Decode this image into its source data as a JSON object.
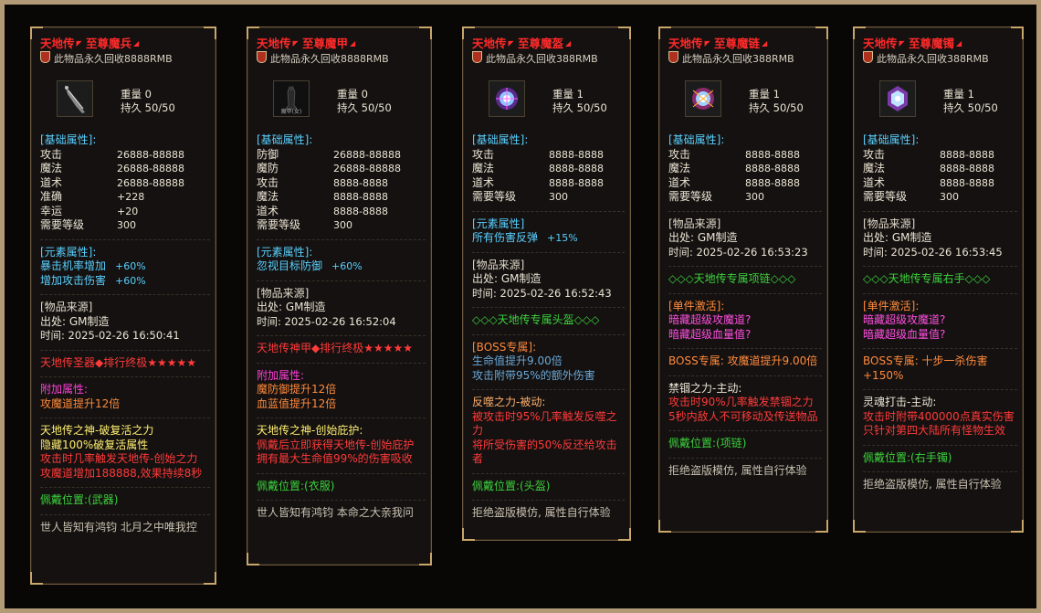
{
  "cards": [
    {
      "title": "天地传",
      "name": "至尊魔兵",
      "recycle": "此物品永久回收8888RMB",
      "weight_label": "重量",
      "weight": "0",
      "dur_label": "持久",
      "dur": "50/50",
      "basic_header": "[基础属性]:",
      "basic": [
        {
          "k": "攻击",
          "v": "26888-88888"
        },
        {
          "k": "魔法",
          "v": "26888-88888"
        },
        {
          "k": "道术",
          "v": "26888-88888"
        },
        {
          "k": "准确",
          "v": "+228"
        },
        {
          "k": "幸运",
          "v": "+20"
        },
        {
          "k": "需要等级",
          "v": "300"
        }
      ],
      "elem_header": "[元素属性]:",
      "elem": [
        {
          "k": "暴击机率增加",
          "v": "+60%"
        },
        {
          "k": "增加攻击伤害",
          "v": "+60%"
        }
      ],
      "source_header": "[物品来源]",
      "source_from": "出处: GM制造",
      "source_time": "时间: 2025-02-26 16:50:41",
      "rank_line": "天地传圣器◆排行终极★★★★★",
      "extra_header": "附加属性:",
      "extra": [
        "攻魔道提升12倍"
      ],
      "god_title": "天地传之神-破复活之力",
      "god_sub": "隐藏100%破复活属性",
      "god_desc": [
        "攻击时几率触发天地传-创始之力",
        "攻魔道增加188888,效果持续8秒"
      ],
      "slot": "佩戴位置:(武器)",
      "footer": "世人皆知有鸿钧 北月之中唯我控"
    },
    {
      "title": "天地传",
      "name": "至尊魔甲",
      "recycle": "此物品永久回收8888RMB",
      "weight_label": "重量",
      "weight": "0",
      "dur_label": "持久",
      "dur": "50/50",
      "icon_text": "魔甲(女)",
      "basic_header": "[基础属性]:",
      "basic": [
        {
          "k": "防御",
          "v": "26888-88888"
        },
        {
          "k": "魔防",
          "v": "26888-88888"
        },
        {
          "k": "攻击",
          "v": "8888-8888"
        },
        {
          "k": "魔法",
          "v": "8888-8888"
        },
        {
          "k": "道术",
          "v": "8888-8888"
        },
        {
          "k": "需要等级",
          "v": "300"
        }
      ],
      "elem_header": "[元素属性]:",
      "elem": [
        {
          "k": "忽视目标防御",
          "v": "+60%"
        }
      ],
      "source_header": "[物品来源]",
      "source_from": "出处: GM制造",
      "source_time": "时间: 2025-02-26 16:52:04",
      "rank_line": "天地传神甲◆排行终极★★★★★",
      "extra_header": "附加属性:",
      "extra": [
        "魔防御提升12倍",
        "血蓝值提升12倍"
      ],
      "god_title": "天地传之神-创始庇护:",
      "god_desc": [
        "佩戴后立即获得天地传-创始庇护",
        "拥有最大生命值99%的伤害吸收"
      ],
      "slot": "佩戴位置:(衣服)",
      "footer": "世人皆知有鸿钧 本命之大亲我问"
    },
    {
      "title": "天地传",
      "name": "至尊魔盔",
      "recycle": "此物品永久回收388RMB",
      "weight_label": "重量",
      "weight": "1",
      "dur_label": "持久",
      "dur": "50/50",
      "basic_header": "[基础属性]:",
      "basic": [
        {
          "k": "攻击",
          "v": "8888-8888"
        },
        {
          "k": "魔法",
          "v": "8888-8888"
        },
        {
          "k": "道术",
          "v": "8888-8888"
        },
        {
          "k": "需要等级",
          "v": "300"
        }
      ],
      "elem_header": "[元素属性]",
      "elem": [
        {
          "k": "所有伤害反弹",
          "v": "+15%"
        }
      ],
      "source_header": "[物品来源]",
      "source_from": "出处: GM制造",
      "source_time": "时间: 2025-02-26 16:52:43",
      "exclusive": "◇◇◇天地传专属头盔◇◇◇",
      "boss_header": "[BOSS专属]:",
      "boss_lines": [
        "生命值提升9.00倍",
        "攻击附带95%的额外伤害"
      ],
      "skill_title": "反噬之力-被动:",
      "skill_desc": [
        "被攻击时95%几率触发反噬之力",
        "将所受伤害的50%反还给攻击者"
      ],
      "slot": "佩戴位置:(头盔)",
      "footer": "拒绝盗版模仿, 属性自行体验"
    },
    {
      "title": "天地传",
      "name": "至尊魔链",
      "recycle": "此物品永久回收388RMB",
      "weight_label": "重量",
      "weight": "1",
      "dur_label": "持久",
      "dur": "50/50",
      "basic_header": "[基础属性]:",
      "basic": [
        {
          "k": "攻击",
          "v": "8888-8888"
        },
        {
          "k": "魔法",
          "v": "8888-8888"
        },
        {
          "k": "道术",
          "v": "8888-8888"
        },
        {
          "k": "需要等级",
          "v": "300"
        }
      ],
      "source_header": "[物品来源]",
      "source_from": "出处: GM制造",
      "source_time": "时间: 2025-02-26 16:53:23",
      "exclusive": "◇◇◇天地传专属项链◇◇◇",
      "single_header": "[单件激活]:",
      "single_lines": [
        "暗藏超级攻魔道?",
        "暗藏超级血量值?"
      ],
      "boss_line": "BOSS专属: 攻魔道提升9.00倍",
      "skill_title": "禁锢之力-主动:",
      "skill_desc": [
        "攻击时90%几率触发禁锢之力",
        "5秒内敌人不可移动及传送物品"
      ],
      "slot": "佩戴位置:(项链)",
      "footer": "拒绝盗版模仿, 属性自行体验"
    },
    {
      "title": "天地传",
      "name": "至尊魔镯",
      "recycle": "此物品永久回收388RMB",
      "weight_label": "重量",
      "weight": "1",
      "dur_label": "持久",
      "dur": "50/50",
      "basic_header": "[基础属性]:",
      "basic": [
        {
          "k": "攻击",
          "v": "8888-8888"
        },
        {
          "k": "魔法",
          "v": "8888-8888"
        },
        {
          "k": "道术",
          "v": "8888-8888"
        },
        {
          "k": "需要等级",
          "v": "300"
        }
      ],
      "source_header": "[物品来源]",
      "source_from": "出处: GM制造",
      "source_time": "时间: 2025-02-26 16:53:45",
      "exclusive": "◇◇◇天地传专属右手◇◇◇",
      "single_header": "[单件激活]:",
      "single_lines": [
        "暗藏超级攻魔道?",
        "暗藏超级血量值?"
      ],
      "boss_line": "BOSS专属: 十步一杀伤害+150%",
      "skill_title": "灵魂打击-主动:",
      "skill_desc": [
        "攻击时附带400000点真实伤害",
        "只针对第四大陆所有怪物生效"
      ],
      "slot": "佩戴位置:(右手镯)",
      "footer": "拒绝盗版模仿, 属性自行体验"
    }
  ]
}
